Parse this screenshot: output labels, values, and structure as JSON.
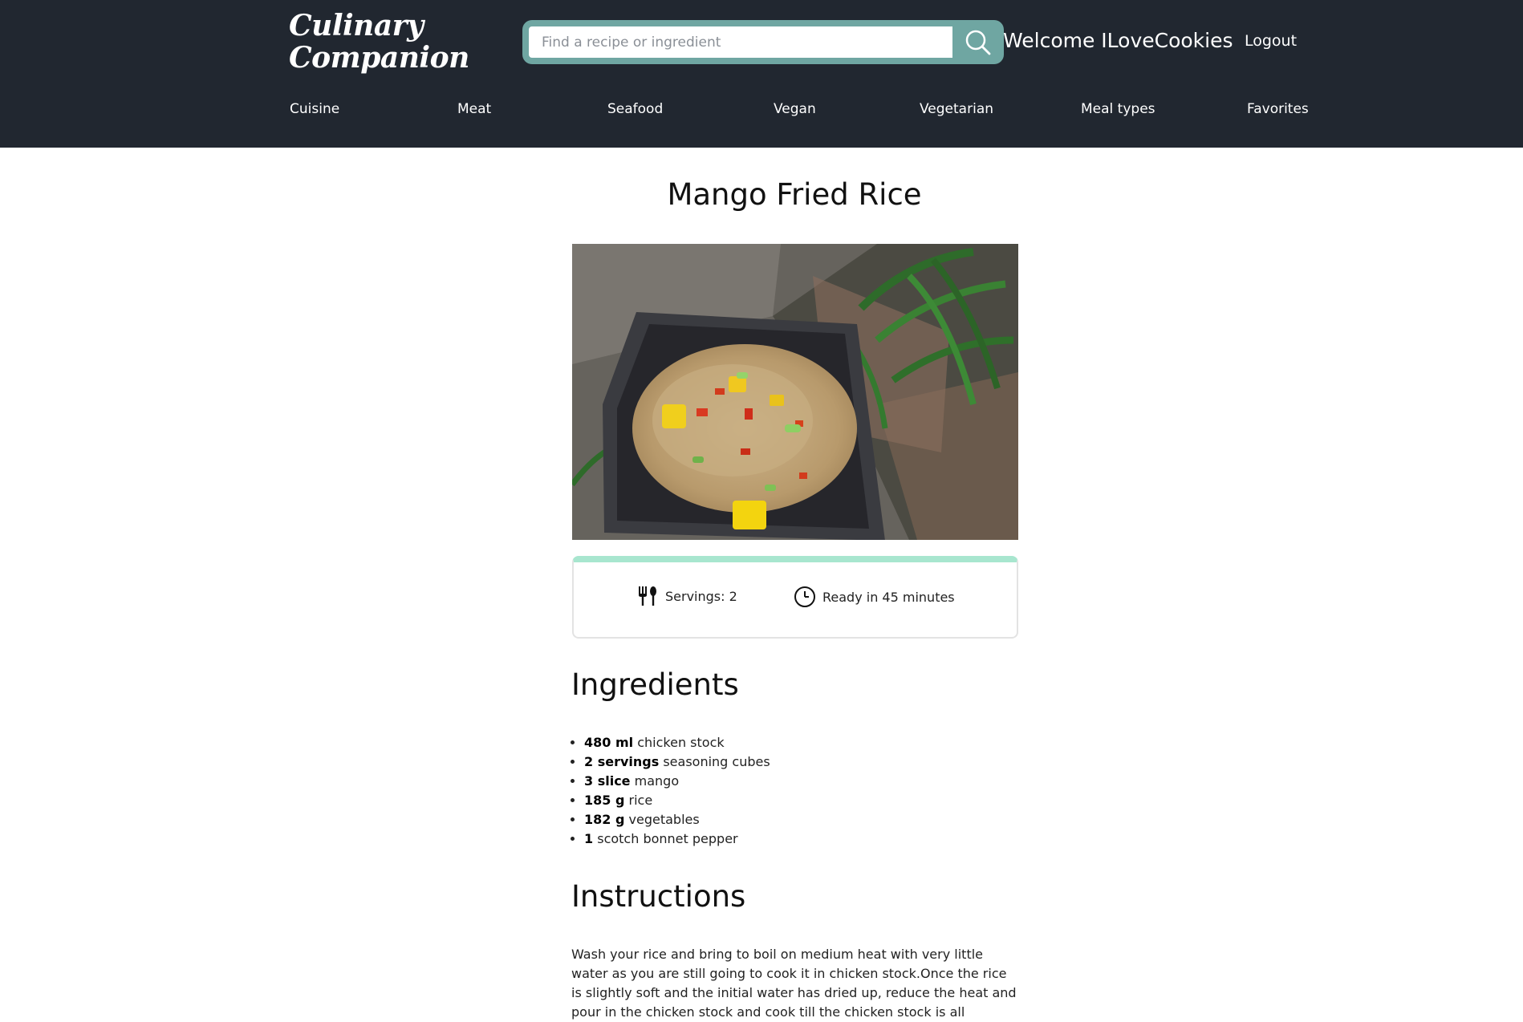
{
  "header": {
    "logo_line1": "Culinary",
    "logo_line2": "Companion",
    "search_placeholder": "Find a recipe or ingredient",
    "search_icon": "search-icon",
    "welcome": "Welcome ILoveCookies",
    "logout": "Logout"
  },
  "nav": {
    "items": [
      "Cuisine",
      "Meat",
      "Seafood",
      "Vegan",
      "Vegetarian",
      "Meal types",
      "Favorites"
    ]
  },
  "recipe": {
    "title": "Mango Fried Rice",
    "servings": "Servings: 2",
    "ready": "Ready in 45 minutes",
    "ingredients_heading": "Ingredients",
    "ingredients": [
      {
        "amount": "480 ml",
        "name": "chicken stock"
      },
      {
        "amount": "2 servings",
        "name": "seasoning cubes"
      },
      {
        "amount": "3 slice",
        "name": "mango"
      },
      {
        "amount": "185 g",
        "name": "rice"
      },
      {
        "amount": "182 g",
        "name": "vegetables"
      },
      {
        "amount": "1",
        "name": "scotch bonnet pepper"
      }
    ],
    "instructions_heading": "Instructions",
    "instructions": "Wash your rice and bring to boil on medium heat with very little water as you are still going to cook it in chicken stock.Once the rice is slightly soft and the initial water has dried up, reduce the heat and pour in the chicken stock and cook till the chicken stock is all"
  },
  "colors": {
    "header_bg": "#212730",
    "search_frame": "#6fa6a2",
    "card_accent": "#a8e6cf"
  }
}
